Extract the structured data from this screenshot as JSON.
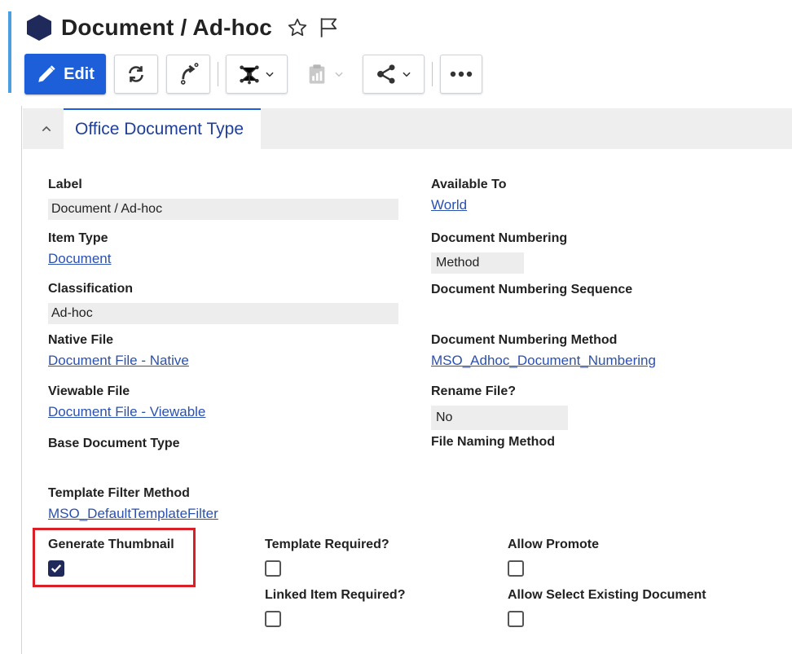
{
  "header": {
    "title": "Document / Ad-hoc",
    "edit_label": "Edit"
  },
  "section": {
    "tab_label": "Office Document Type"
  },
  "fields": {
    "label": {
      "label": "Label",
      "value": "Document / Ad-hoc"
    },
    "item_type": {
      "label": "Item Type",
      "value": "Document"
    },
    "classification": {
      "label": "Classification",
      "value": "Ad-hoc"
    },
    "native_file": {
      "label": "Native File",
      "value": "Document File - Native"
    },
    "viewable_file": {
      "label": "Viewable File",
      "value": "Document File - Viewable"
    },
    "base_document_type": {
      "label": "Base Document Type",
      "value": ""
    },
    "template_filter_method": {
      "label": "Template Filter Method",
      "value": "MSO_DefaultTemplateFilter"
    },
    "available_to": {
      "label": "Available To",
      "value": "World"
    },
    "document_numbering": {
      "label": "Document Numbering",
      "value": "Method"
    },
    "document_numbering_sequence": {
      "label": "Document Numbering Sequence",
      "value": ""
    },
    "document_numbering_method": {
      "label": "Document Numbering Method",
      "value": "MSO_Adhoc_Document_Numbering"
    },
    "rename_file": {
      "label": "Rename File?",
      "value": "No"
    },
    "file_naming_method": {
      "label": "File Naming Method",
      "value": ""
    }
  },
  "checkboxes": {
    "generate_thumbnail": {
      "label": "Generate Thumbnail",
      "checked": true
    },
    "template_required": {
      "label": "Template Required?",
      "checked": false
    },
    "linked_item_required": {
      "label": "Linked Item Required?",
      "checked": false
    },
    "allow_promote": {
      "label": "Allow Promote",
      "checked": false
    },
    "allow_select_existing_document": {
      "label": "Allow Select Existing Document",
      "checked": false
    }
  },
  "colors": {
    "primary": "#1c5fd8",
    "brand_dark": "#1f2a5b",
    "link": "#2a50b0",
    "highlight": "#d92027"
  },
  "icons": {
    "title_icon": "hexagon-icon",
    "favorite": "star-outline-icon",
    "flag": "flag-icon",
    "edit": "pencil-icon",
    "refresh": "refresh-icon",
    "promote": "promote-arrow-icon",
    "structure": "network-icon",
    "report": "clipboard-chart-icon",
    "share": "share-icon",
    "more": "more-dots-icon",
    "collapse": "chevron-up-icon",
    "check": "check-icon"
  }
}
